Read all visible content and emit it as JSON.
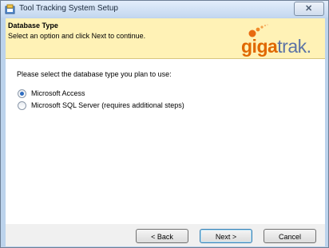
{
  "window": {
    "title": "Tool Tracking System Setup",
    "close_label": "✕"
  },
  "banner": {
    "title": "Database Type",
    "subtitle": "Select an option and click Next to continue.",
    "logo_giga": "giga",
    "logo_trak": "trak.",
    "logo_colors": {
      "giga": "#e06800",
      "trak": "#5b73a6"
    }
  },
  "content": {
    "prompt": "Please select the database type you plan to use:",
    "options": [
      {
        "label": "Microsoft Access",
        "selected": true
      },
      {
        "label": "Microsoft SQL Server (requires additional steps)",
        "selected": false
      }
    ]
  },
  "buttons": {
    "back": "< Back",
    "next": "Next >",
    "cancel": "Cancel"
  },
  "icons": {
    "app": "setup-icon",
    "close": "close-icon"
  }
}
